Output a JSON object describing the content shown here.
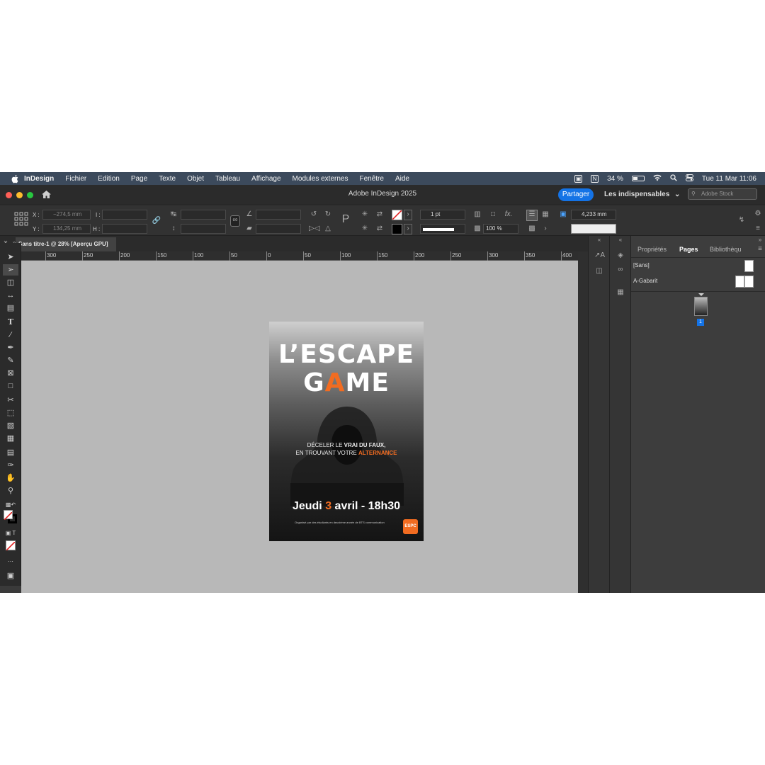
{
  "menubar": {
    "app": "InDesign",
    "items": [
      "Fichier",
      "Edition",
      "Page",
      "Texte",
      "Objet",
      "Tableau",
      "Affichage",
      "Modules externes",
      "Fenêtre",
      "Aide"
    ],
    "battery": "34 %",
    "clock": "Tue 11 Mar  11:06"
  },
  "window": {
    "title": "Adobe InDesign 2025",
    "share_label": "Partager",
    "workspace": "Les indispensables",
    "stock_placeholder": "Adobe Stock"
  },
  "controls": {
    "x_label": "X :",
    "y_label": "Y :",
    "x_value": "−274,5 mm",
    "y_value": "134,25 mm",
    "w_label": "I :",
    "h_label": "H :",
    "stroke_weight": "1 pt",
    "opacity": "100 %",
    "corner_size": "4,233 mm"
  },
  "document": {
    "tab_label": "Sans titre-1 @ 28% [Aperçu GPU]",
    "ruler_ticks": [
      "300",
      "250",
      "200",
      "150",
      "100",
      "50",
      "0",
      "50",
      "100",
      "150",
      "200",
      "250",
      "300",
      "350",
      "400"
    ]
  },
  "panel": {
    "tabs": [
      "Propriétés",
      "Pages",
      "Bibliothèqu"
    ],
    "active_tab": "Pages",
    "none_master": "[Sans]",
    "master_a": "A-Gabarit",
    "page_number": "1"
  },
  "poster": {
    "title_line1": "L’ESCAPE",
    "title_line2_a": "G",
    "title_line2_b": "A",
    "title_line2_c": "ME",
    "tagline1_a": "DÉCELER LE ",
    "tagline1_b": "VRAI DU FAUX,",
    "tagline2_a": "EN TROUVANT VOTRE ",
    "tagline2_b": "ALTERNANCE",
    "date_a": "Jeudi ",
    "date_b": "3",
    "date_c": " avril - 18h30",
    "note": "Organisé par des étudiants en deuxième année de BTS communication",
    "logo": "ESPC"
  },
  "colors": {
    "accent": "#1473e6",
    "poster_orange": "#f26c21",
    "menubar": "#3c4a5c"
  }
}
